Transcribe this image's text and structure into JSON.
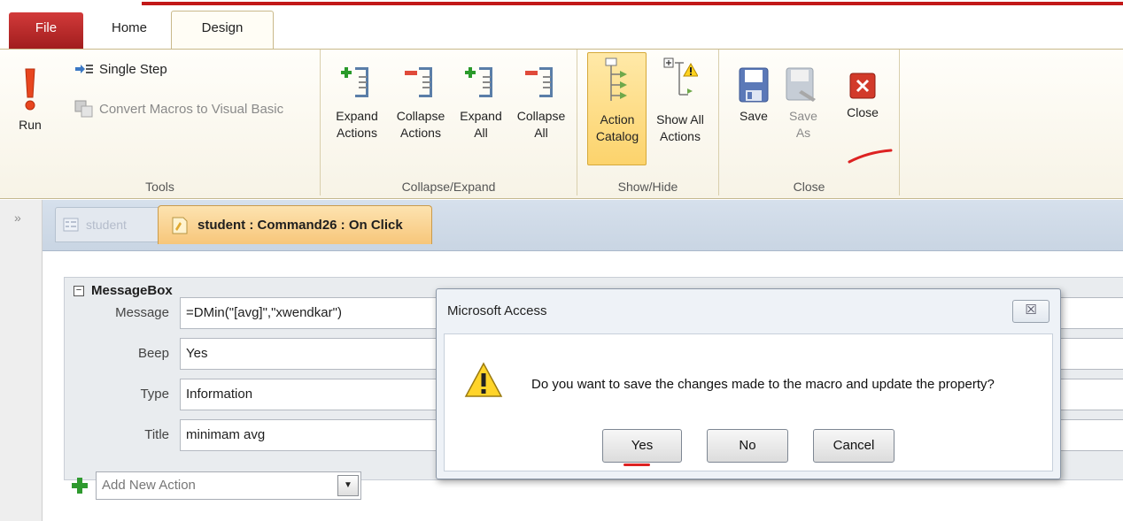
{
  "ribbon_tabs": {
    "file": "File",
    "home": "Home",
    "design": "Design"
  },
  "ribbon": {
    "tools": {
      "label": "Tools",
      "run": "Run",
      "single_step": "Single Step",
      "convert": "Convert Macros to Visual Basic"
    },
    "collapse_expand": {
      "label": "Collapse/Expand",
      "expand_actions": [
        "Expand",
        "Actions"
      ],
      "collapse_actions": [
        "Collapse",
        "Actions"
      ],
      "expand_all": [
        "Expand",
        "All"
      ],
      "collapse_all": [
        "Collapse",
        "All"
      ]
    },
    "show_hide": {
      "label": "Show/Hide",
      "action_catalog": [
        "Action",
        "Catalog"
      ],
      "show_all_actions": [
        "Show All",
        "Actions"
      ]
    },
    "close": {
      "label": "Close",
      "save": "Save",
      "save_as": [
        "Save",
        "As"
      ],
      "close": "Close"
    }
  },
  "doc_tabs": {
    "inactive": "student",
    "active": "student : Command26 : On Click"
  },
  "macro": {
    "action": "MessageBox",
    "args": [
      {
        "label": "Message",
        "value": "=DMin(\"[avg]\",\"xwendkar\")"
      },
      {
        "label": "Beep",
        "value": "Yes"
      },
      {
        "label": "Type",
        "value": "Information"
      },
      {
        "label": "Title",
        "value": "minimam avg"
      }
    ],
    "add_new_action_placeholder": "Add New Action"
  },
  "dialog": {
    "title": "Microsoft Access",
    "message": "Do you want to save the changes made to the macro and update the property?",
    "yes": "Yes",
    "no": "No",
    "cancel": "Cancel"
  },
  "colors": {
    "accent_red": "#c21818",
    "file_tab": "#b82525",
    "active_doc_tab": "#f7c67a"
  }
}
